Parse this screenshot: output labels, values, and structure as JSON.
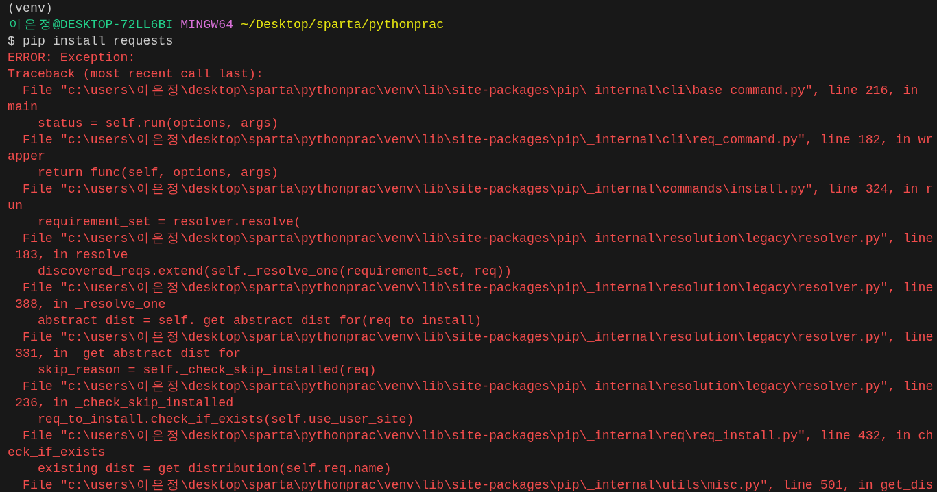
{
  "terminal": {
    "lines": [
      {
        "kind": "plain",
        "text": "(venv)"
      },
      {
        "kind": "prompt",
        "user": "이은정@DESKTOP-72LL6BI",
        "system": "MINGW64",
        "path": "~/Desktop/sparta/pythonprac"
      },
      {
        "kind": "plain",
        "text": "$ pip install requests"
      },
      {
        "kind": "error",
        "text": "ERROR: Exception:"
      },
      {
        "kind": "error",
        "text": "Traceback (most recent call last):"
      },
      {
        "kind": "error",
        "text": "  File \"c:\\users\\이은정\\desktop\\sparta\\pythonprac\\venv\\lib\\site-packages\\pip\\_internal\\cli\\base_command.py\", line 216, in _"
      },
      {
        "kind": "error",
        "text": "main"
      },
      {
        "kind": "error",
        "text": "    status = self.run(options, args)"
      },
      {
        "kind": "error",
        "text": "  File \"c:\\users\\이은정\\desktop\\sparta\\pythonprac\\venv\\lib\\site-packages\\pip\\_internal\\cli\\req_command.py\", line 182, in wr"
      },
      {
        "kind": "error",
        "text": "apper"
      },
      {
        "kind": "error",
        "text": "    return func(self, options, args)"
      },
      {
        "kind": "error",
        "text": "  File \"c:\\users\\이은정\\desktop\\sparta\\pythonprac\\venv\\lib\\site-packages\\pip\\_internal\\commands\\install.py\", line 324, in r"
      },
      {
        "kind": "error",
        "text": "un"
      },
      {
        "kind": "error",
        "text": "    requirement_set = resolver.resolve("
      },
      {
        "kind": "error",
        "text": "  File \"c:\\users\\이은정\\desktop\\sparta\\pythonprac\\venv\\lib\\site-packages\\pip\\_internal\\resolution\\legacy\\resolver.py\", line"
      },
      {
        "kind": "error",
        "text": " 183, in resolve"
      },
      {
        "kind": "error",
        "text": "    discovered_reqs.extend(self._resolve_one(requirement_set, req))"
      },
      {
        "kind": "error",
        "text": "  File \"c:\\users\\이은정\\desktop\\sparta\\pythonprac\\venv\\lib\\site-packages\\pip\\_internal\\resolution\\legacy\\resolver.py\", line"
      },
      {
        "kind": "error",
        "text": " 388, in _resolve_one"
      },
      {
        "kind": "error",
        "text": "    abstract_dist = self._get_abstract_dist_for(req_to_install)"
      },
      {
        "kind": "error",
        "text": "  File \"c:\\users\\이은정\\desktop\\sparta\\pythonprac\\venv\\lib\\site-packages\\pip\\_internal\\resolution\\legacy\\resolver.py\", line"
      },
      {
        "kind": "error",
        "text": " 331, in _get_abstract_dist_for"
      },
      {
        "kind": "error",
        "text": "    skip_reason = self._check_skip_installed(req)"
      },
      {
        "kind": "error",
        "text": "  File \"c:\\users\\이은정\\desktop\\sparta\\pythonprac\\venv\\lib\\site-packages\\pip\\_internal\\resolution\\legacy\\resolver.py\", line"
      },
      {
        "kind": "error",
        "text": " 236, in _check_skip_installed"
      },
      {
        "kind": "error",
        "text": "    req_to_install.check_if_exists(self.use_user_site)"
      },
      {
        "kind": "error",
        "text": "  File \"c:\\users\\이은정\\desktop\\sparta\\pythonprac\\venv\\lib\\site-packages\\pip\\_internal\\req\\req_install.py\", line 432, in ch"
      },
      {
        "kind": "error",
        "text": "eck_if_exists"
      },
      {
        "kind": "error",
        "text": "    existing_dist = get_distribution(self.req.name)"
      },
      {
        "kind": "error",
        "text": "  File \"c:\\users\\이은정\\desktop\\sparta\\pythonprac\\venv\\lib\\site-packages\\pip\\_internal\\utils\\misc.py\", line 501, in get_dis"
      }
    ]
  }
}
